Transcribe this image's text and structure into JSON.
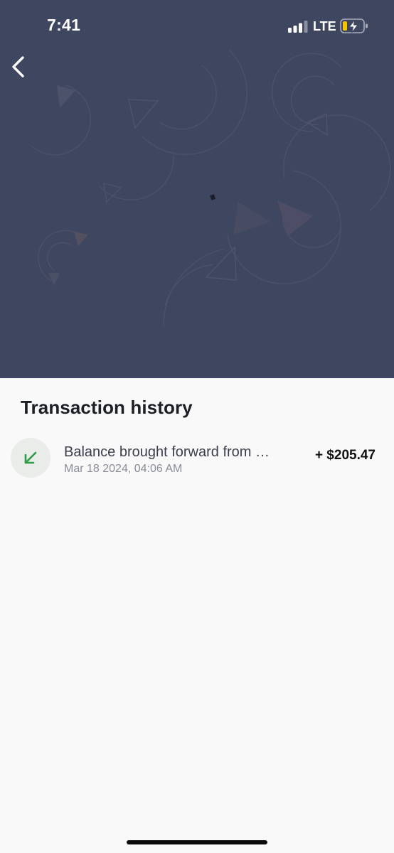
{
  "status_bar": {
    "time": "7:41",
    "network": "LTE",
    "signal_icon": "cellular-signal-icon",
    "battery_icon": "battery-charging-icon",
    "battery_level": 0.2,
    "battery_color": "#f5c400"
  },
  "header": {
    "back_icon": "chevron-left-icon",
    "background_color": "#3f4660"
  },
  "transactions": {
    "title": "Transaction history",
    "items": [
      {
        "icon": "arrow-down-left-icon",
        "icon_color": "#2f9a48",
        "description": "Balance brought forward from …",
        "date": "Mar 18 2024, 04:06 AM",
        "amount": "+  $205.47"
      }
    ]
  }
}
